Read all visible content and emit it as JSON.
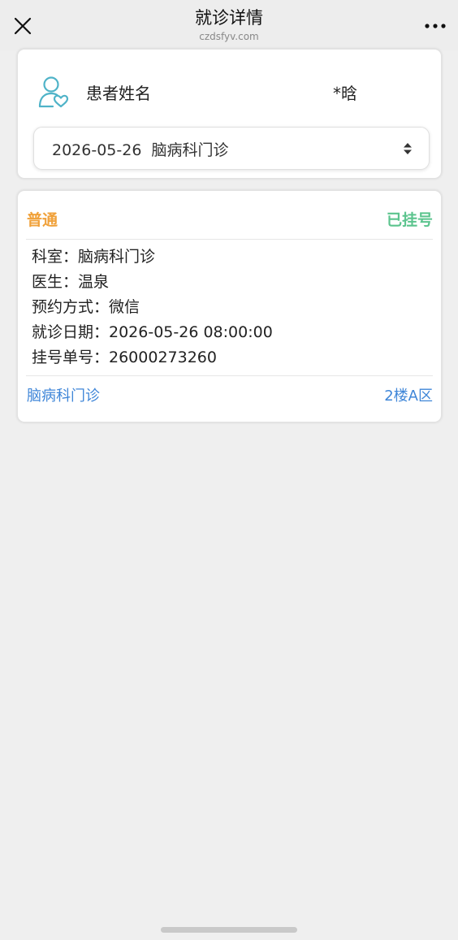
{
  "nav": {
    "title": "就诊详情",
    "domain": "czdsfyv.com",
    "close_icon": "close-icon",
    "more_icon": "more-dots-icon"
  },
  "patient": {
    "label": "患者姓名",
    "name": "*晗",
    "icon": "patient-heart-icon",
    "accent_color": "#4fb3c8"
  },
  "visit_select": {
    "value": "2026-05-26  脑病科门诊",
    "icon": "sort-arrows-icon"
  },
  "appointment": {
    "type": "普通",
    "status": "已挂号",
    "type_color": "#f0a13a",
    "status_color": "#5cc48e",
    "details": [
      "科室：脑病科门诊",
      "医生：温泉",
      "预约方式：微信",
      "就诊日期：2026-05-26 08:00:00",
      "挂号单号：26000273260"
    ],
    "department_link": "脑病科门诊",
    "location_link": "2楼A区",
    "link_color": "#3f86d8"
  }
}
